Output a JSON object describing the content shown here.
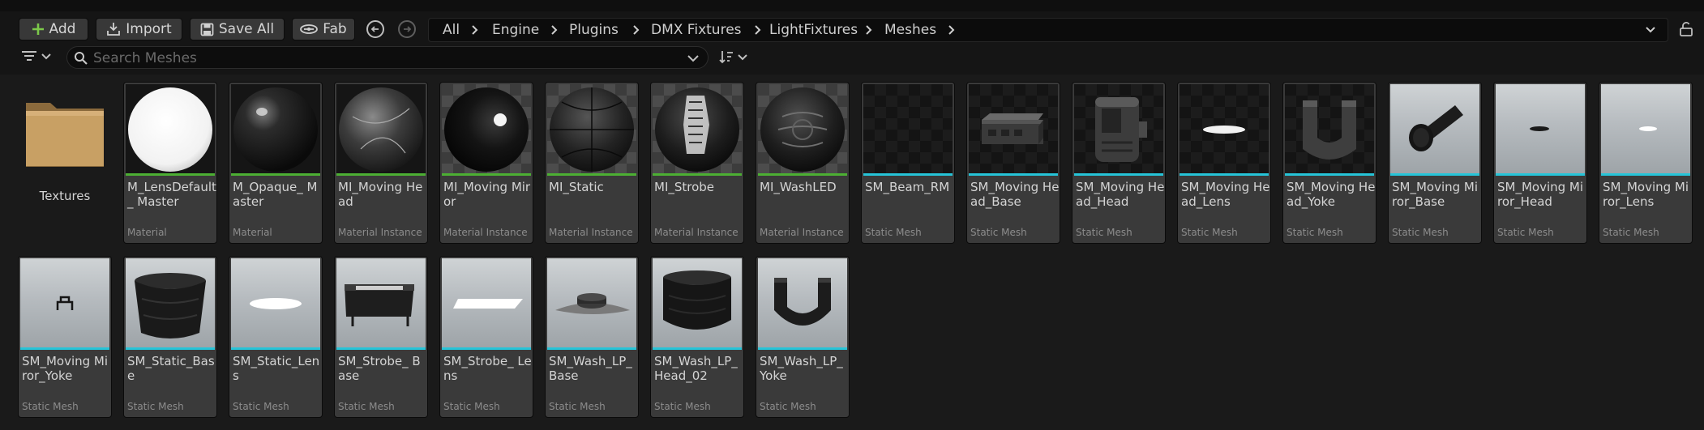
{
  "toolbar": {
    "add_label": "Add",
    "import_label": "Import",
    "save_all_label": "Save All",
    "fab_label": "Fab",
    "add_icon": "plus-icon",
    "import_icon": "import-icon",
    "save_icon": "save-icon",
    "fab_icon": "fab-icon"
  },
  "breadcrumb": [
    "All",
    "Engine",
    "Plugins",
    "DMX Fixtures",
    "LightFixtures",
    "Meshes"
  ],
  "search": {
    "placeholder": "Search Meshes",
    "value": ""
  },
  "colors": {
    "material_stripe": "#4caf33",
    "mesh_stripe": "#26c4d8",
    "add_icon": "#7cc94a"
  },
  "folder": {
    "name": "Textures"
  },
  "assets": [
    {
      "name": "M_LensDefault_ Master",
      "type": "Material"
    },
    {
      "name": "M_Opaque_ Master",
      "type": "Material"
    },
    {
      "name": "MI_Moving Head",
      "type": "Material Instance"
    },
    {
      "name": "MI_Moving Miror",
      "type": "Material Instance"
    },
    {
      "name": "MI_Static",
      "type": "Material Instance"
    },
    {
      "name": "MI_Strobe",
      "type": "Material Instance"
    },
    {
      "name": "MI_WashLED",
      "type": "Material Instance"
    },
    {
      "name": "SM_Beam_RM",
      "type": "Static Mesh"
    },
    {
      "name": "SM_Moving Head_Base",
      "type": "Static Mesh"
    },
    {
      "name": "SM_Moving Head_Head",
      "type": "Static Mesh"
    },
    {
      "name": "SM_Moving Head_Lens",
      "type": "Static Mesh"
    },
    {
      "name": "SM_Moving Head_Yoke",
      "type": "Static Mesh"
    },
    {
      "name": "SM_Moving Miror_Base",
      "type": "Static Mesh"
    },
    {
      "name": "SM_Moving Miror_Head",
      "type": "Static Mesh"
    },
    {
      "name": "SM_Moving Miror_Lens",
      "type": "Static Mesh"
    },
    {
      "name": "SM_Moving Miror_Yoke",
      "type": "Static Mesh"
    },
    {
      "name": "SM_Static_Base",
      "type": "Static Mesh"
    },
    {
      "name": "SM_Static_Lens",
      "type": "Static Mesh"
    },
    {
      "name": "SM_Strobe_ Base",
      "type": "Static Mesh"
    },
    {
      "name": "SM_Strobe_ Lens",
      "type": "Static Mesh"
    },
    {
      "name": "SM_Wash_LP_ Base",
      "type": "Static Mesh"
    },
    {
      "name": "SM_Wash_LP_ Head_02",
      "type": "Static Mesh"
    },
    {
      "name": "SM_Wash_LP_ Yoke",
      "type": "Static Mesh"
    }
  ]
}
